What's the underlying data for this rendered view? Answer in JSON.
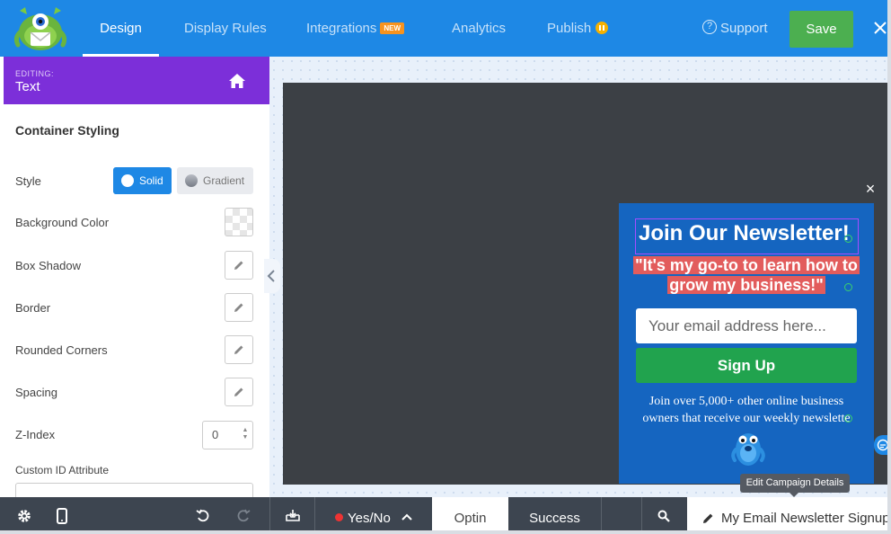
{
  "nav": {
    "tabs": [
      {
        "label": "Design"
      },
      {
        "label": "Display Rules"
      },
      {
        "label": "Integrations",
        "badge": "NEW"
      },
      {
        "label": "Analytics"
      },
      {
        "label": "Publish"
      }
    ],
    "support_label": "Support",
    "save_label": "Save",
    "close_icon": "close-icon"
  },
  "sidebar": {
    "editing_label": "EDITING:",
    "editing_value": "Text",
    "section_title": "Container Styling",
    "style_label": "Style",
    "style_options": [
      "Solid",
      "Gradient"
    ],
    "style_selected": "Solid",
    "background_color_label": "Background Color",
    "box_shadow_label": "Box Shadow",
    "border_label": "Border",
    "rounded_corners_label": "Rounded Corners",
    "spacing_label": "Spacing",
    "zindex_label": "Z-Index",
    "zindex_value": "0",
    "custom_id_label": "Custom ID Attribute",
    "custom_id_value": ""
  },
  "popup": {
    "title": "Join Our Newsletter!",
    "quote": "\"It's my go-to to learn how to grow my business!\"",
    "email_placeholder": "Your email address here...",
    "signup_label": "Sign Up",
    "blurb_line1": "Join over 5,000+ other online business",
    "blurb_line2": "owners that receive our weekly newslette",
    "close_symbol": "×"
  },
  "tooltip": "Edit Campaign Details",
  "bottom": {
    "yesno_label": "Yes/No",
    "optin_label": "Optin",
    "success_label": "Success",
    "campaign_name": "My Email Newsletter Signup"
  },
  "colors": {
    "topbar": "#1e88e5",
    "editing_bar": "#7c2fd9",
    "save": "#4caf50",
    "signup": "#21a34e",
    "popup_bg": "#1565c0",
    "quote_highlight": "#e25c5c",
    "new_badge": "#f7931e"
  }
}
